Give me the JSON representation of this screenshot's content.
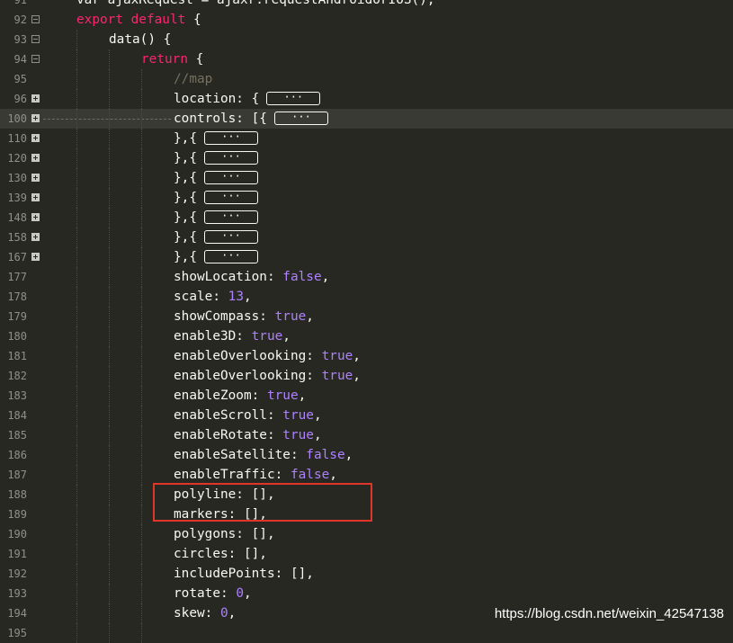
{
  "editor": {
    "lines": [
      {
        "num": "91",
        "segs": [
          [
            "plain",
            "var ajaxRequest = ajaxr.requestAndroidorIOS();"
          ]
        ]
      },
      {
        "num": "92",
        "fold": "minus",
        "segs": [
          [
            "kw",
            "export default"
          ],
          [
            "plain",
            " {"
          ]
        ]
      },
      {
        "num": "93",
        "fold": "minus",
        "segs": [
          [
            "plain",
            "data() {"
          ]
        ]
      },
      {
        "num": "94",
        "fold": "minus",
        "segs": [
          [
            "kw",
            "return"
          ],
          [
            "plain",
            " {"
          ]
        ]
      },
      {
        "num": "95",
        "segs": [
          [
            "cm",
            "//map"
          ]
        ]
      },
      {
        "num": "96",
        "fold": "plus",
        "segs": [
          [
            "plain",
            "location: {"
          ]
        ],
        "pill": "···"
      },
      {
        "num": "100",
        "fold": "plus",
        "active": true,
        "segs": [
          [
            "plain",
            "controls: [{"
          ]
        ],
        "pill": "···"
      },
      {
        "num": "110",
        "fold": "plus",
        "segs": [
          [
            "plain",
            "},{"
          ]
        ],
        "pill": "···"
      },
      {
        "num": "120",
        "fold": "plus",
        "segs": [
          [
            "plain",
            "},{"
          ]
        ],
        "pill": "···"
      },
      {
        "num": "130",
        "fold": "plus",
        "segs": [
          [
            "plain",
            "},{"
          ]
        ],
        "pill": "···"
      },
      {
        "num": "139",
        "fold": "plus",
        "segs": [
          [
            "plain",
            "},{"
          ]
        ],
        "pill": "···"
      },
      {
        "num": "148",
        "fold": "plus",
        "segs": [
          [
            "plain",
            "},{"
          ]
        ],
        "pill": "···"
      },
      {
        "num": "158",
        "fold": "plus",
        "segs": [
          [
            "plain",
            "},{"
          ]
        ],
        "pill": "···"
      },
      {
        "num": "167",
        "fold": "plus",
        "segs": [
          [
            "plain",
            "},{"
          ]
        ],
        "pill": "···"
      },
      {
        "num": "177",
        "segs": [
          [
            "plain",
            "showLocation: "
          ],
          [
            "bool",
            "false"
          ],
          [
            "plain",
            ","
          ]
        ]
      },
      {
        "num": "178",
        "segs": [
          [
            "plain",
            "scale: "
          ],
          [
            "num",
            "13"
          ],
          [
            "plain",
            ","
          ]
        ]
      },
      {
        "num": "179",
        "segs": [
          [
            "plain",
            "showCompass: "
          ],
          [
            "bool",
            "true"
          ],
          [
            "plain",
            ","
          ]
        ]
      },
      {
        "num": "180",
        "segs": [
          [
            "plain",
            "enable3D: "
          ],
          [
            "bool",
            "true"
          ],
          [
            "plain",
            ","
          ]
        ]
      },
      {
        "num": "181",
        "segs": [
          [
            "plain",
            "enableOverlooking: "
          ],
          [
            "bool",
            "true"
          ],
          [
            "plain",
            ","
          ]
        ]
      },
      {
        "num": "182",
        "segs": [
          [
            "plain",
            "enableOverlooking: "
          ],
          [
            "bool",
            "true"
          ],
          [
            "plain",
            ","
          ]
        ]
      },
      {
        "num": "183",
        "segs": [
          [
            "plain",
            "enableZoom: "
          ],
          [
            "bool",
            "true"
          ],
          [
            "plain",
            ","
          ]
        ]
      },
      {
        "num": "184",
        "segs": [
          [
            "plain",
            "enableScroll: "
          ],
          [
            "bool",
            "true"
          ],
          [
            "plain",
            ","
          ]
        ]
      },
      {
        "num": "185",
        "segs": [
          [
            "plain",
            "enableRotate: "
          ],
          [
            "bool",
            "true"
          ],
          [
            "plain",
            ","
          ]
        ]
      },
      {
        "num": "186",
        "segs": [
          [
            "plain",
            "enableSatellite: "
          ],
          [
            "bool",
            "false"
          ],
          [
            "plain",
            ","
          ]
        ]
      },
      {
        "num": "187",
        "segs": [
          [
            "plain",
            "enableTraffic: "
          ],
          [
            "bool",
            "false"
          ],
          [
            "plain",
            ","
          ]
        ]
      },
      {
        "num": "188",
        "segs": [
          [
            "plain",
            "polyline: [],"
          ]
        ]
      },
      {
        "num": "189",
        "segs": [
          [
            "plain",
            "markers: [],"
          ]
        ]
      },
      {
        "num": "190",
        "segs": [
          [
            "plain",
            "polygons: [],"
          ]
        ]
      },
      {
        "num": "191",
        "segs": [
          [
            "plain",
            "circles: [],"
          ]
        ]
      },
      {
        "num": "192",
        "segs": [
          [
            "plain",
            "includePoints: [],"
          ]
        ]
      },
      {
        "num": "193",
        "segs": [
          [
            "plain",
            "rotate: "
          ],
          [
            "num",
            "0"
          ],
          [
            "plain",
            ","
          ]
        ]
      },
      {
        "num": "194",
        "segs": [
          [
            "plain",
            "skew: "
          ],
          [
            "num",
            "0"
          ],
          [
            "plain",
            ","
          ]
        ]
      },
      {
        "num": "195",
        "segs": [
          [
            "plain",
            ""
          ]
        ]
      }
    ]
  },
  "watermark": "https://blog.csdn.net/weixin_42547138",
  "colors": {
    "background": "#272822",
    "keyword": "#f92672",
    "literal": "#ae81ff",
    "comment": "#75715e",
    "highlight_box": "#e0352b"
  }
}
